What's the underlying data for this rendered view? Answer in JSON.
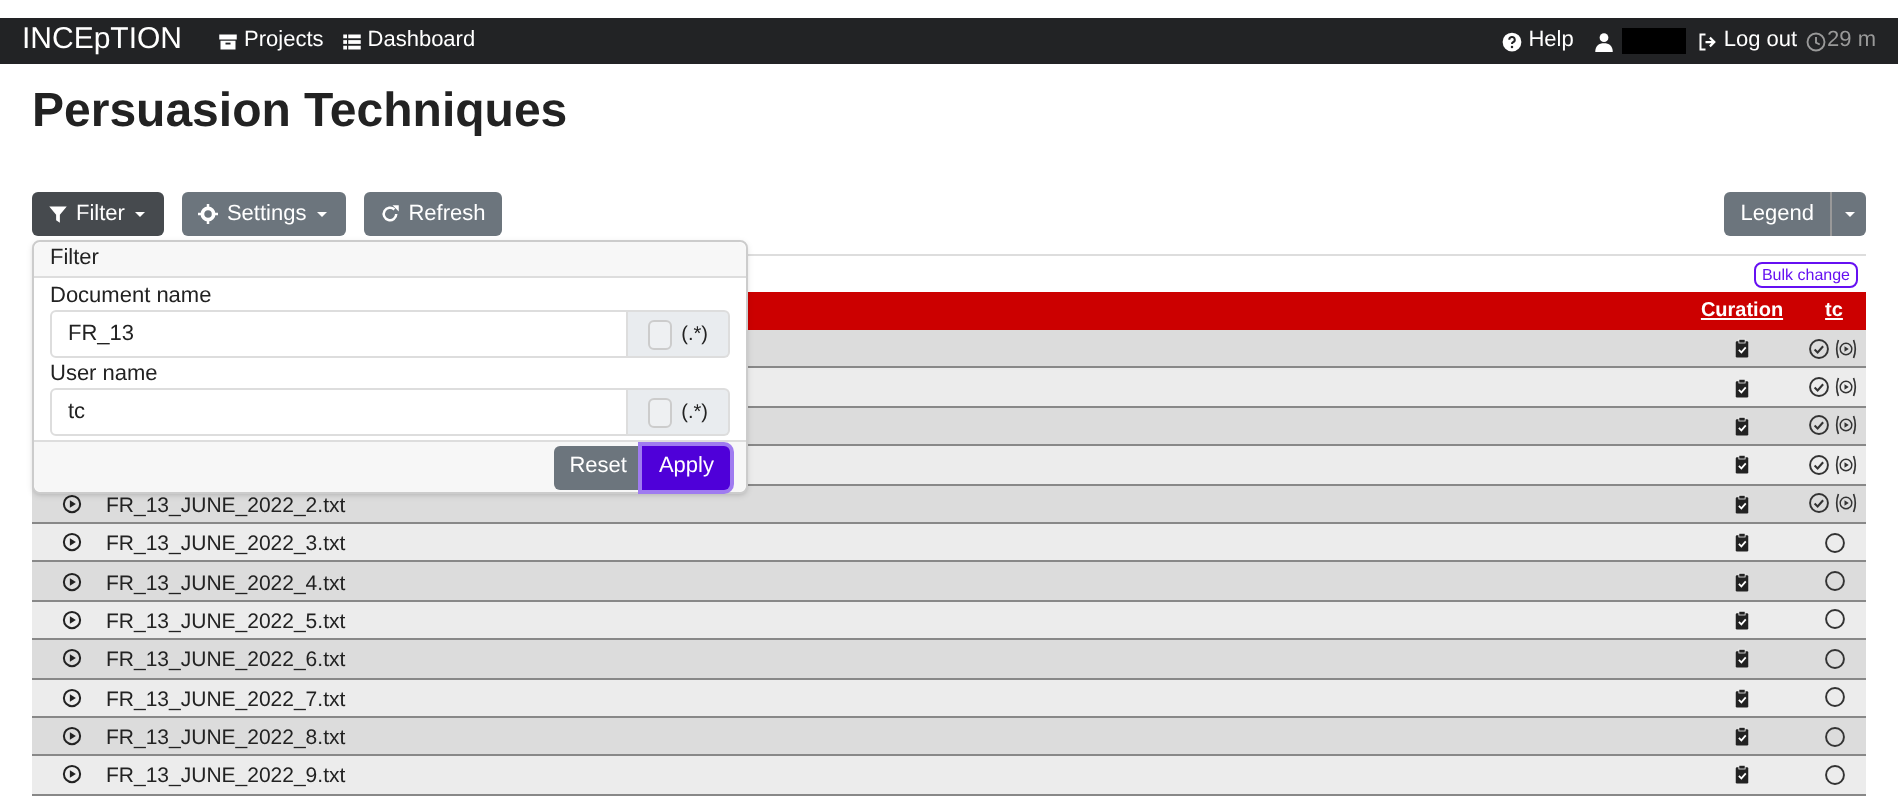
{
  "navbar": {
    "brand": "INCEpTION",
    "links": [
      {
        "label": "Projects",
        "kind": "projects"
      },
      {
        "label": "Dashboard",
        "kind": "dashboard"
      }
    ],
    "help": "Help",
    "logout": "Log out",
    "session_time": "29 m"
  },
  "title": "Persuasion Techniques",
  "toolbar": {
    "filter": "Filter",
    "settings": "Settings",
    "refresh": "Refresh",
    "legend": "Legend"
  },
  "table": {
    "bulk_change": "Bulk change",
    "columns": [
      "Curation",
      "tc"
    ],
    "rows": [
      {
        "kind": "finished"
      },
      {
        "kind": "finished"
      },
      {
        "kind": "finished"
      },
      {
        "kind": "finished"
      },
      {
        "name": "FR_13_JUNE_2022_2.txt",
        "kind": "finished"
      },
      {
        "name": "FR_13_JUNE_2022_3.txt",
        "kind": "new"
      },
      {
        "name": "FR_13_JUNE_2022_4.txt",
        "kind": "new"
      },
      {
        "name": "FR_13_JUNE_2022_5.txt",
        "kind": "new"
      },
      {
        "name": "FR_13_JUNE_2022_6.txt",
        "kind": "new"
      },
      {
        "name": "FR_13_JUNE_2022_7.txt",
        "kind": "new"
      },
      {
        "name": "FR_13_JUNE_2022_8.txt",
        "kind": "new"
      },
      {
        "name": "FR_13_JUNE_2022_9.txt",
        "kind": "new"
      }
    ]
  },
  "filter_popup": {
    "title": "Filter",
    "fields": [
      {
        "label": "Document name",
        "value": "FR_13",
        "regex_label": "(.*)",
        "regex_checked": false
      },
      {
        "label": "User name",
        "value": "tc",
        "regex_label": "(.*)",
        "regex_checked": false
      }
    ],
    "reset": "Reset",
    "apply": "Apply"
  }
}
